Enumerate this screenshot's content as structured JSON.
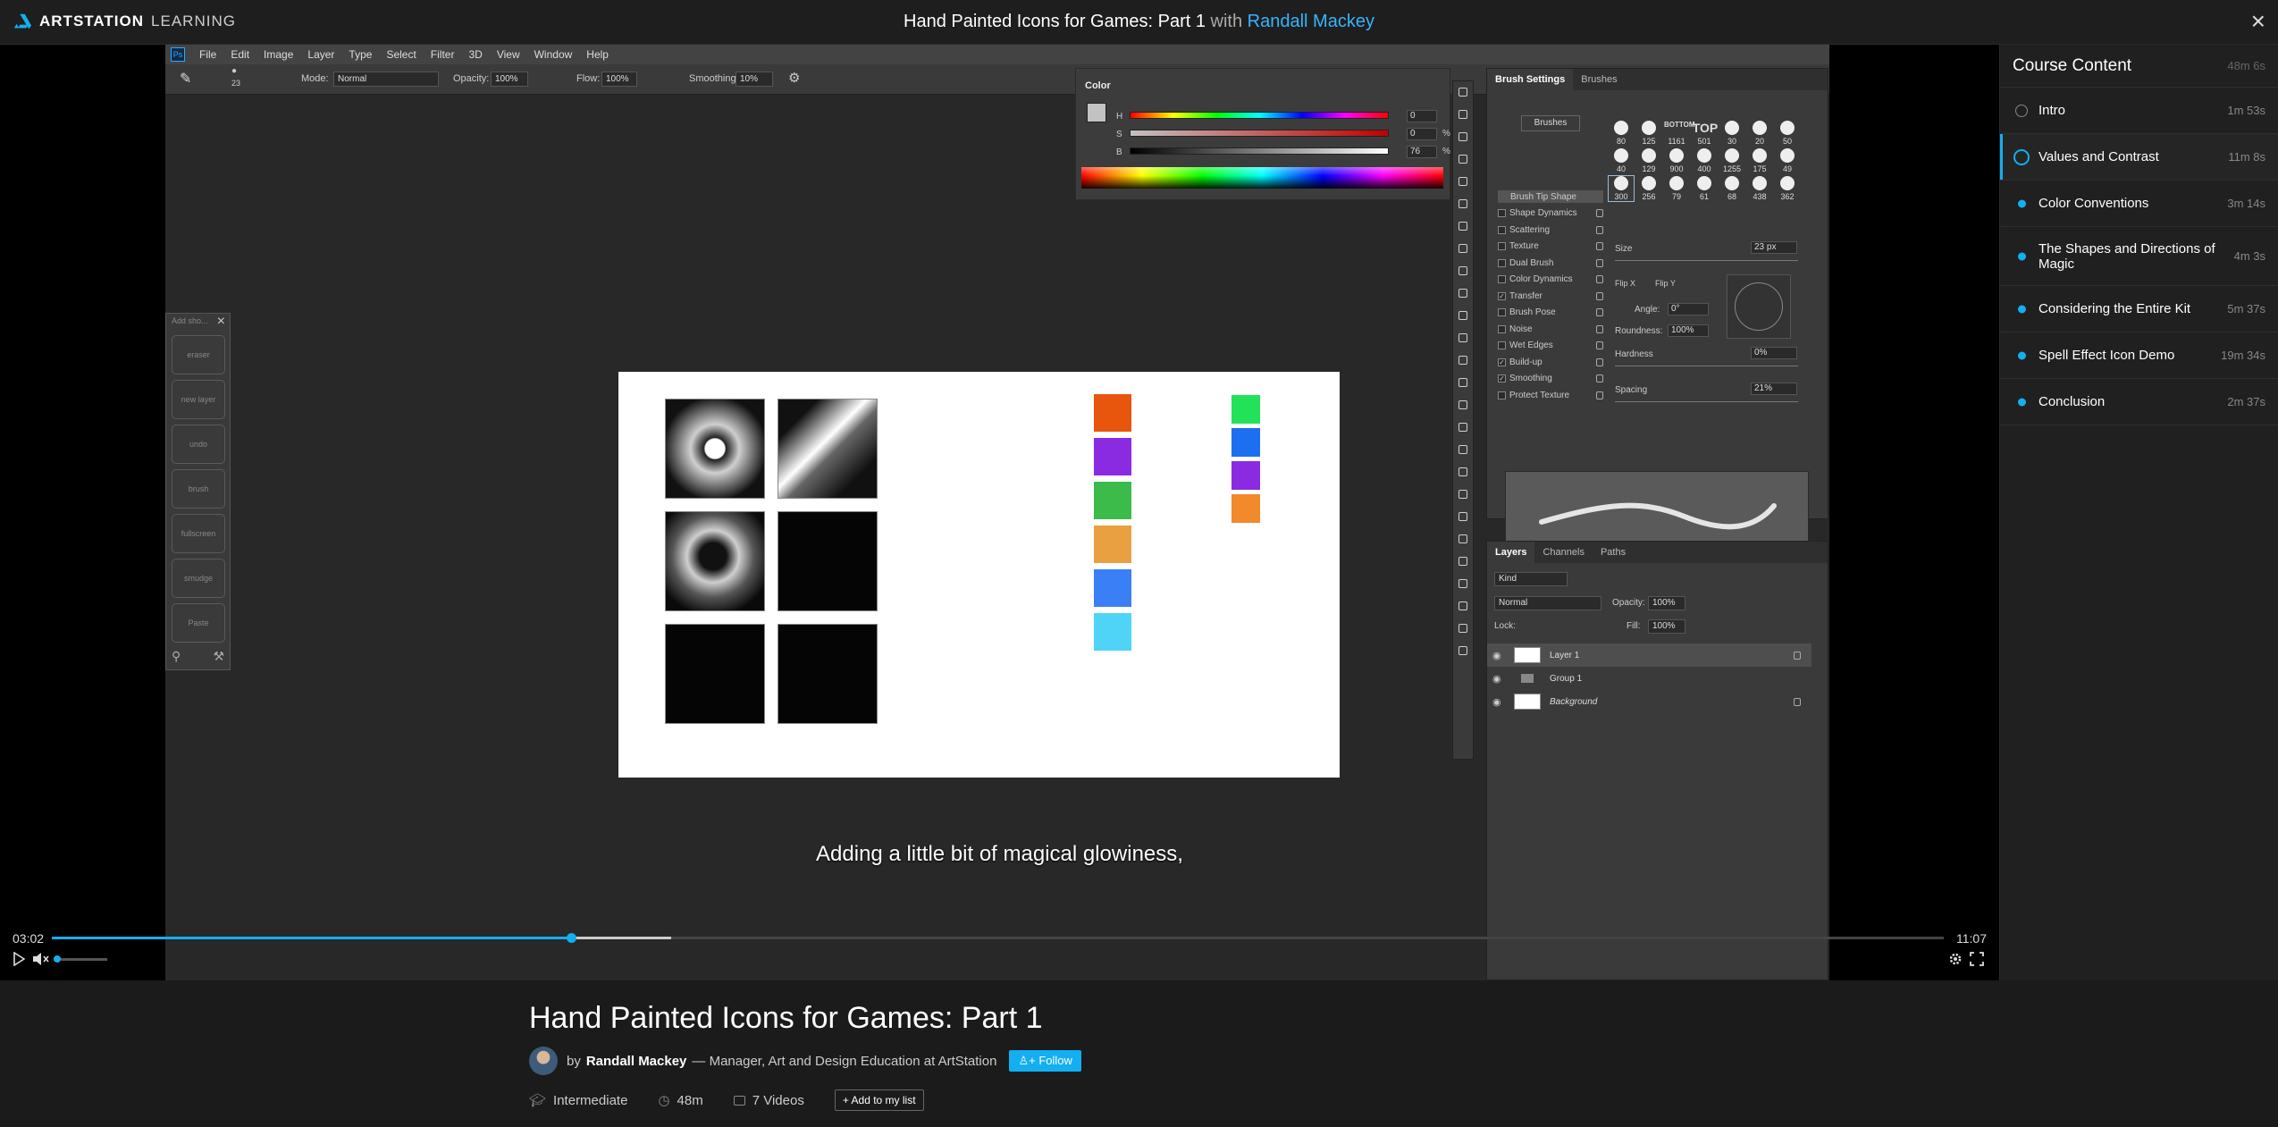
{
  "header": {
    "logo_brand": "ARTSTATION",
    "logo_sub": "LEARNING",
    "title": "Hand Painted Icons for Games: Part 1",
    "with_word": "with",
    "instructor": "Randall Mackey",
    "close_icon": "close-icon"
  },
  "photoshop": {
    "menu": [
      "File",
      "Edit",
      "Image",
      "Layer",
      "Type",
      "Select",
      "Filter",
      "3D",
      "View",
      "Window",
      "Help"
    ],
    "options": {
      "brush_size": "23",
      "mode_label": "Mode:",
      "mode_value": "Normal",
      "opacity_label": "Opacity:",
      "opacity_value": "100%",
      "flow_label": "Flow:",
      "flow_value": "100%",
      "smoothing_label": "Smoothing:",
      "smoothing_value": "10%"
    },
    "left_panel": {
      "header": "Add sho...",
      "buttons": [
        "eraser",
        "new layer",
        "undo",
        "brush",
        "fullscreen",
        "smudge",
        "Paste"
      ]
    },
    "color_panel": {
      "tab": "Color",
      "h_label": "H",
      "h_value": "0",
      "s_label": "S",
      "s_value": "0",
      "s_unit": "%",
      "b_label": "B",
      "b_value": "76",
      "b_unit": "%"
    },
    "brush_settings": {
      "tabs": [
        "Brush Settings",
        "Brushes"
      ],
      "brushes_button": "Brushes",
      "options": [
        {
          "label": "Brush Tip Shape",
          "checked": null
        },
        {
          "label": "Shape Dynamics",
          "checked": false
        },
        {
          "label": "Scattering",
          "checked": false
        },
        {
          "label": "Texture",
          "checked": false
        },
        {
          "label": "Dual Brush",
          "checked": false
        },
        {
          "label": "Color Dynamics",
          "checked": false
        },
        {
          "label": "Transfer",
          "checked": true
        },
        {
          "label": "Brush Pose",
          "checked": false
        },
        {
          "label": "Noise",
          "checked": false
        },
        {
          "label": "Wet Edges",
          "checked": false
        },
        {
          "label": "Build-up",
          "checked": true
        },
        {
          "label": "Smoothing",
          "checked": true
        },
        {
          "label": "Protect Texture",
          "checked": false
        }
      ],
      "tip_rows": [
        [
          "80",
          "125",
          "1161",
          "501",
          "30",
          "20",
          "50"
        ],
        [
          "40",
          "129",
          "900",
          "400",
          "1255",
          "175",
          "49"
        ],
        [
          "300",
          "256",
          "79",
          "61",
          "68",
          "438",
          "362"
        ]
      ],
      "tip_text_bottom": "BOTTOM",
      "tip_text_top": "TOP",
      "size_label": "Size",
      "size_value": "23 px",
      "flip_x": "Flip X",
      "flip_y": "Flip Y",
      "angle_label": "Angle:",
      "angle_value": "0°",
      "roundness_label": "Roundness:",
      "roundness_value": "100%",
      "hardness_label": "Hardness",
      "hardness_value": "0%",
      "spacing_label": "Spacing",
      "spacing_value": "21%"
    },
    "layers_panel": {
      "tabs": [
        "Layers",
        "Channels",
        "Paths"
      ],
      "kind": "Kind",
      "blend": "Normal",
      "opacity_label": "Opacity:",
      "opacity_value": "100%",
      "lock_label": "Lock:",
      "fill_label": "Fill:",
      "fill_value": "100%",
      "layers": [
        {
          "name": "Layer 1",
          "locked": true
        },
        {
          "name": "Group 1",
          "locked": false
        },
        {
          "name": "Background",
          "locked": true
        }
      ]
    },
    "swatches_col1": [
      "#e8560e",
      "#8a2be2",
      "#3cba4a",
      "#e8a040",
      "#3a7ff5",
      "#4fd4f7"
    ],
    "swatches_col2": [
      "#22e25a",
      "#1d6ff2",
      "#8a2be2",
      "#f2892a"
    ]
  },
  "video": {
    "subtitle": "Adding a little bit of magical glowiness,",
    "current_time": "03:02",
    "total_time": "11:07",
    "progress": 0.2743,
    "buffered": 0.3275,
    "volume": 0.0
  },
  "sidebar": {
    "title": "Course Content",
    "total": "48m 6s",
    "items": [
      {
        "label": "Intro",
        "duration": "1m 53s",
        "state": "completed"
      },
      {
        "label": "Values and Contrast",
        "duration": "11m 8s",
        "state": "playing"
      },
      {
        "label": "Color Conventions",
        "duration": "3m 14s",
        "state": "pending"
      },
      {
        "label": "The Shapes and Directions of Magic",
        "duration": "4m 3s",
        "state": "pending"
      },
      {
        "label": "Considering the Entire Kit",
        "duration": "5m 37s",
        "state": "pending"
      },
      {
        "label": "Spell Effect Icon Demo",
        "duration": "19m 34s",
        "state": "pending"
      },
      {
        "label": "Conclusion",
        "duration": "2m 37s",
        "state": "pending"
      }
    ]
  },
  "info": {
    "title": "Hand Painted Icons for Games: Part 1",
    "by": "by",
    "author": "Randall Mackey",
    "role": "— Manager, Art and Design Education at ArtStation",
    "follow": "Follow",
    "level": "Intermediate",
    "length": "48m",
    "videos": "7 Videos",
    "add_to_list": "Add to my list"
  },
  "colors": {
    "accent": "#13aff0",
    "instructor_link": "#35b5ff"
  }
}
